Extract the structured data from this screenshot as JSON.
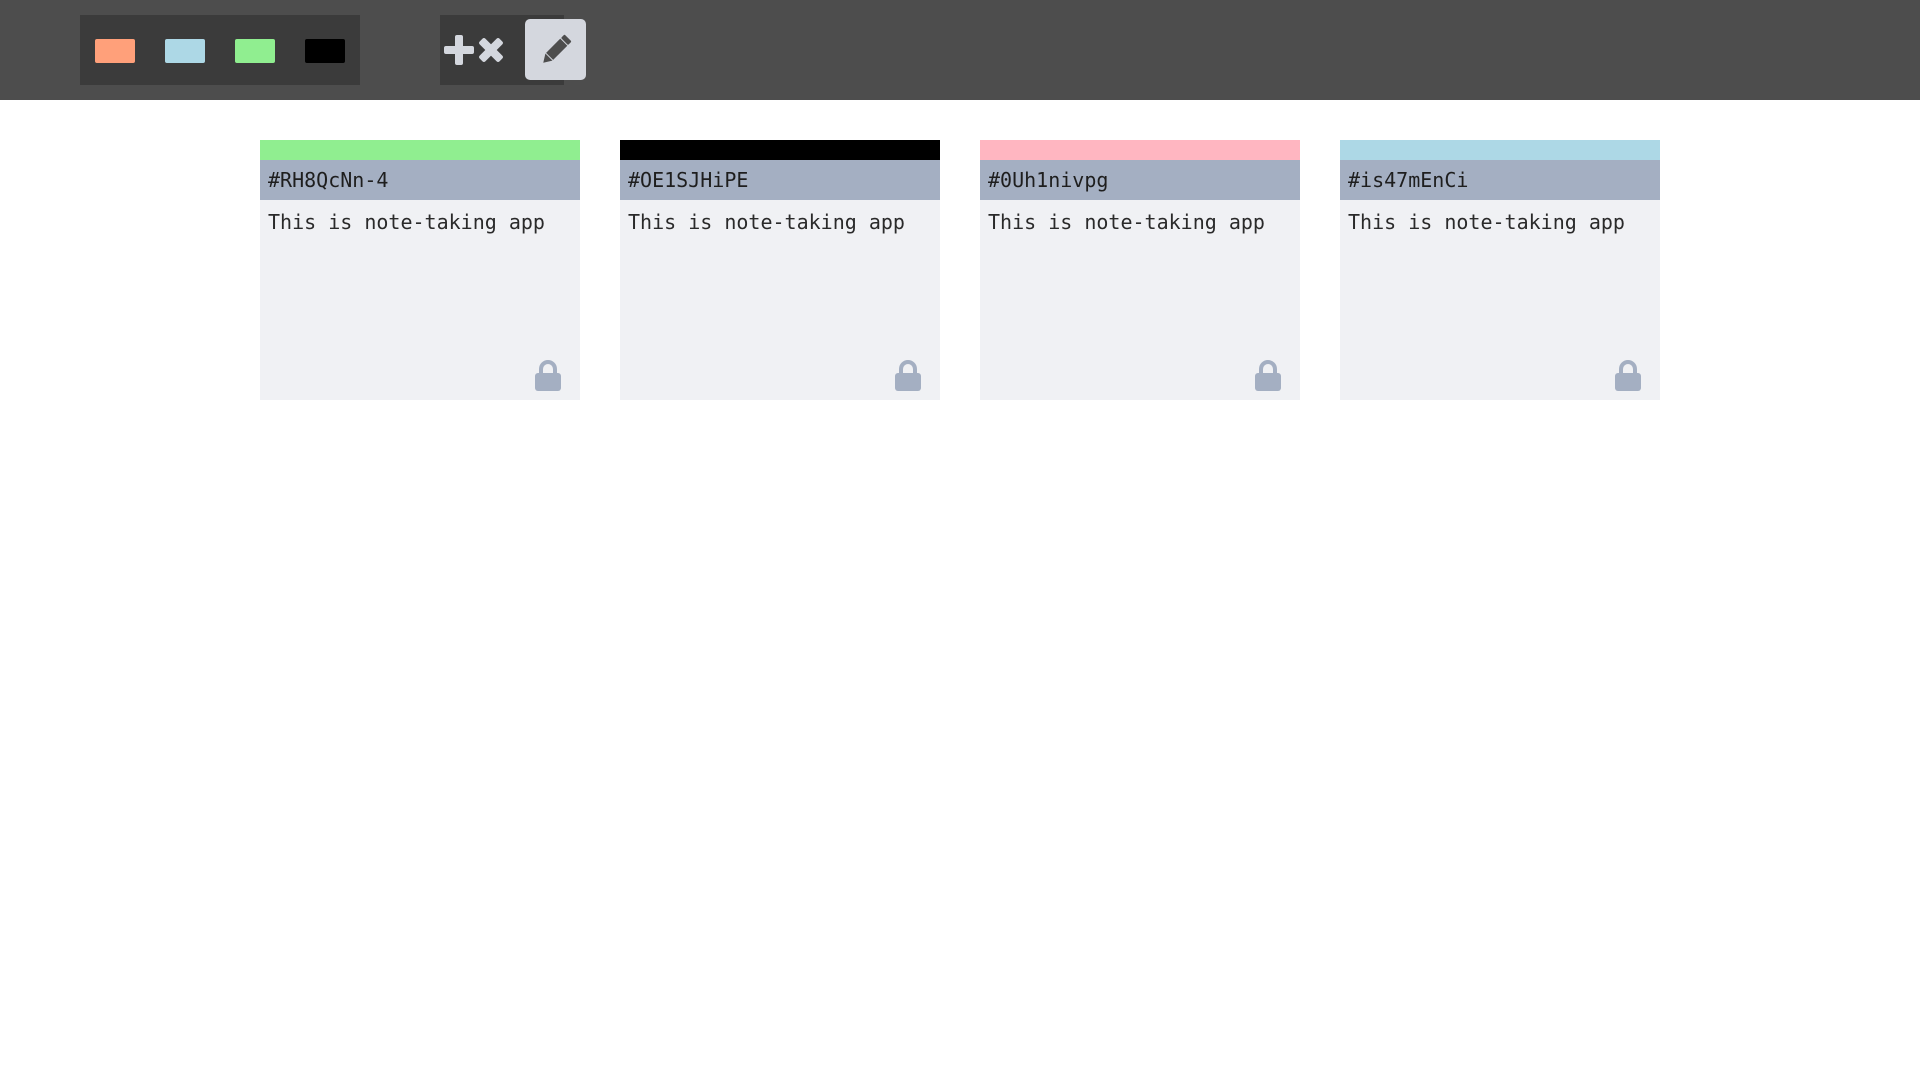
{
  "toolbar": {
    "palette": [
      {
        "name": "orange",
        "color": "#ffa07a"
      },
      {
        "name": "light-blue",
        "color": "#add8e6"
      },
      {
        "name": "light-green",
        "color": "#90ee90"
      },
      {
        "name": "black",
        "color": "#000000"
      }
    ],
    "clear_icon": "plus-times-icon",
    "edit_icon": "pencil-icon"
  },
  "notes": [
    {
      "id": "#RH8QcNn-4",
      "text": "This is note-taking app",
      "color": "#90ee90",
      "icon": "lock-icon"
    },
    {
      "id": "#OE1SJHiPE",
      "text": "This is note-taking app",
      "color": "#000000",
      "icon": "lock-icon"
    },
    {
      "id": "#0Uh1nivpg",
      "text": "This is note-taking app",
      "color": "#ffb6c1",
      "icon": "lock-icon"
    },
    {
      "id": "#is47mEnCi",
      "text": "This is note-taking app",
      "color": "#add8e6",
      "icon": "lock-icon"
    }
  ]
}
